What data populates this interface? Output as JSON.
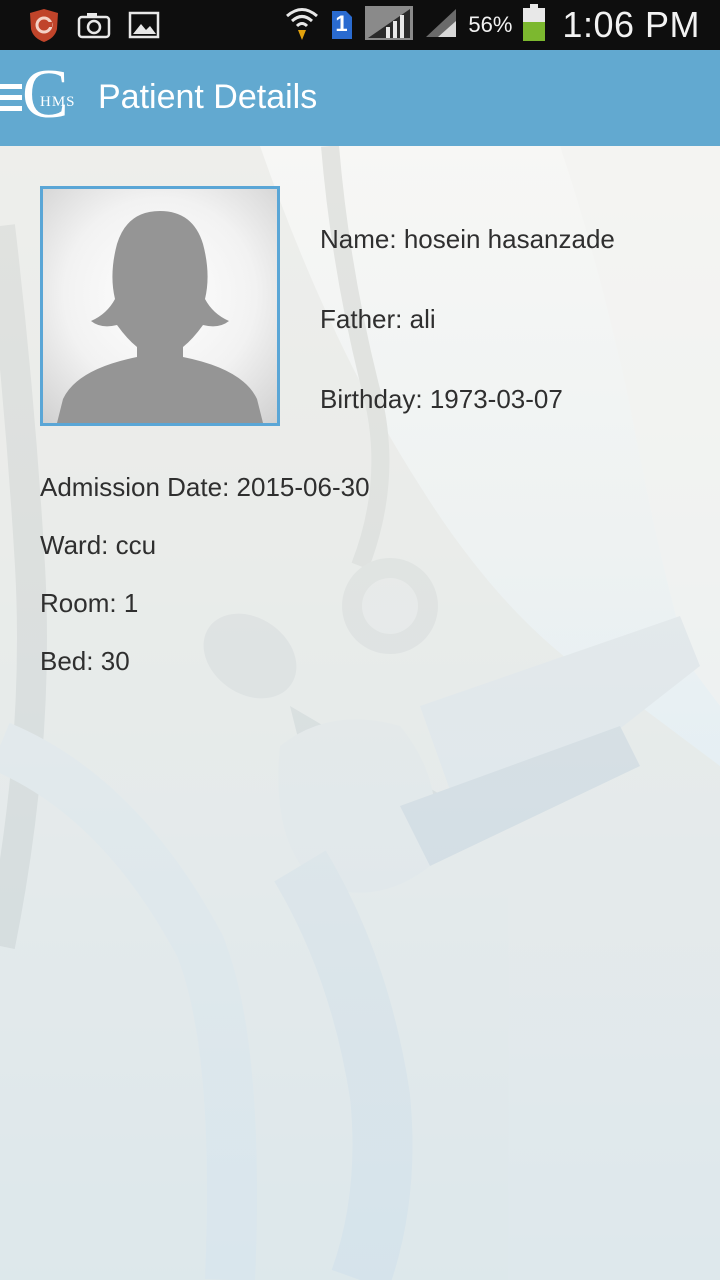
{
  "status_bar": {
    "battery_percent": "56%",
    "time": "1:06 PM",
    "sim_badge": "1",
    "icons": [
      "shield-app-icon",
      "camera-icon",
      "gallery-icon",
      "wifi-icon",
      "sim-icon",
      "signal-icon",
      "battery-icon"
    ]
  },
  "app_bar": {
    "logo_letter": "C",
    "logo_sub": "HMS",
    "title": "Patient Details"
  },
  "patient": {
    "name_label": "Name:",
    "name": "hosein hasanzade",
    "father_label": "Father:",
    "father": "ali",
    "birthday_label": "Birthday:",
    "birthday": "1973-03-07",
    "admission_label": "Admission Date:",
    "admission_date": "2015-06-30",
    "ward_label": "Ward:",
    "ward": "ccu",
    "room_label": "Room:",
    "room": "1",
    "bed_label": "Bed:",
    "bed": "30"
  },
  "colors": {
    "app_bar": "#62a9d0",
    "photo_border": "#5aa6d6",
    "text": "#2f2f2f"
  }
}
